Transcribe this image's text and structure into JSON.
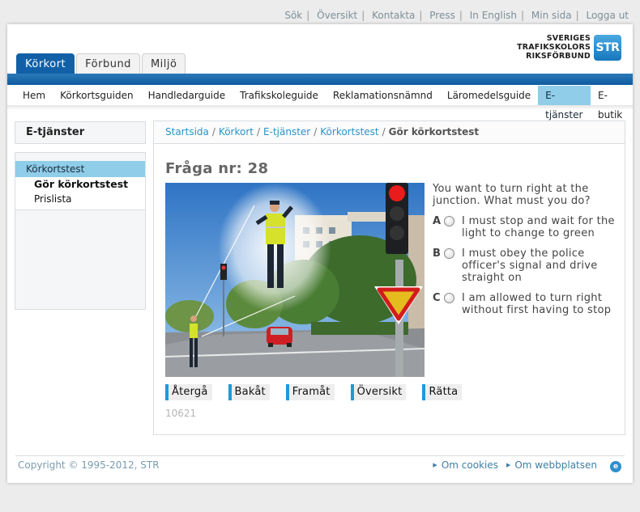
{
  "top_links": [
    "Sök",
    "Översikt",
    "Kontakta",
    "Press",
    "In English",
    "Min sida",
    "Logga ut"
  ],
  "logo": {
    "line1": "SVERIGES",
    "line2": "TRAFIKSKOLORS",
    "line3": "RIKSFÖRBUND",
    "badge": "STR"
  },
  "tabs": [
    "Körkort",
    "Förbund",
    "Miljö"
  ],
  "main_nav": [
    "Hem",
    "Körkortsguiden",
    "Handledarguide",
    "Trafikskoleguide",
    "Reklamationsnämnd",
    "Läromedelsguide",
    "E-tjänster",
    "E-butik"
  ],
  "sidebar": {
    "title": "E-tjänster",
    "active_item": "Körkortstest",
    "sub_items": [
      "Gör körkortstest",
      "Prislista"
    ]
  },
  "breadcrumb": [
    "Startsida",
    "Körkort",
    "E-tjänster",
    "Körkortstest",
    "Gör körkortstest"
  ],
  "question": {
    "title": "Fråga nr: 28",
    "text": "You want to turn right at the junction. What must you do?",
    "options": [
      {
        "letter": "A",
        "text": "I must stop and wait for the light to change to green"
      },
      {
        "letter": "B",
        "text": "I must obey the police officer's signal and drive straight on"
      },
      {
        "letter": "C",
        "text": "I am allowed to turn right without first having to stop"
      }
    ],
    "id": "10621"
  },
  "buttons": [
    "Återgå",
    "Bakåt",
    "Framåt",
    "Översikt",
    "Rätta"
  ],
  "footer": {
    "copyright": "Copyright © 1995-2012, STR",
    "links": [
      "Om cookies",
      "Om webbplatsen"
    ]
  },
  "colors": {
    "brand_blue": "#1160a7",
    "accent_light": "#8fcde9",
    "link": "#2a95c9"
  },
  "icons": {
    "footer": "external-help-icon"
  }
}
